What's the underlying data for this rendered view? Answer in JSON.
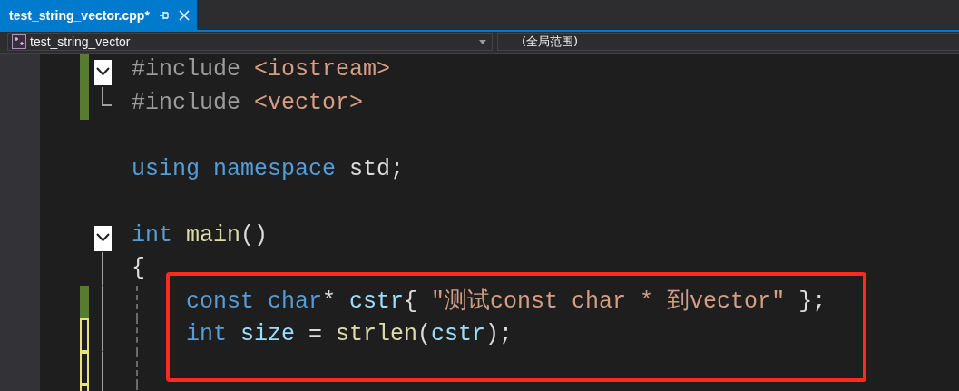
{
  "tabs": [
    {
      "label": "test_string_vector.cpp*",
      "selected": true
    }
  ],
  "nav": {
    "project": "test_string_vector",
    "scope": "(全局范围)"
  },
  "annotation_box": {
    "color": "#ff2a1f"
  },
  "lines": [
    {
      "kind": "fold-start",
      "modified": true,
      "saved": true,
      "guide": false,
      "boxed": false,
      "tokens": [
        {
          "text": "#include ",
          "kind": "preproc"
        },
        {
          "text": "<iostream>",
          "kind": "string"
        }
      ]
    },
    {
      "kind": "fold-end",
      "modified": true,
      "saved": true,
      "guide": false,
      "boxed": false,
      "tokens": [
        {
          "text": "#include ",
          "kind": "preproc"
        },
        {
          "text": "<vector>",
          "kind": "string"
        }
      ]
    },
    {
      "kind": "plain",
      "modified": false,
      "guide": false,
      "boxed": false
    },
    {
      "kind": "plain",
      "modified": false,
      "guide": false,
      "boxed": false,
      "tokens": [
        {
          "text": "using namespace",
          "kind": "keyword"
        },
        {
          "text": " std;",
          "kind": "plain"
        }
      ]
    },
    {
      "kind": "plain",
      "modified": false,
      "guide": false,
      "boxed": false
    },
    {
      "kind": "fold-start",
      "modified": false,
      "guide": false,
      "boxed": false,
      "tokens": [
        {
          "text": "int ",
          "kind": "keyword"
        },
        {
          "text": "main",
          "kind": "function"
        },
        {
          "text": "()",
          "kind": "plain"
        }
      ]
    },
    {
      "kind": "fold-body",
      "modified": false,
      "guide": false,
      "boxed": false,
      "tokens": [
        {
          "text": "{",
          "kind": "plain"
        }
      ]
    },
    {
      "kind": "fold-body",
      "modified": true,
      "saved": true,
      "guide": true,
      "boxed": true,
      "tokens": [
        {
          "text": "const char",
          "kind": "keyword"
        },
        {
          "text": "* ",
          "kind": "plain"
        },
        {
          "text": "cstr",
          "kind": "variable"
        },
        {
          "text": "{ ",
          "kind": "plain"
        },
        {
          "text": "\"测试const char * 到vector\"",
          "kind": "string"
        },
        {
          "text": " };",
          "kind": "plain"
        }
      ]
    },
    {
      "kind": "fold-body",
      "modified": true,
      "saved": false,
      "guide": true,
      "boxed": true,
      "tokens": [
        {
          "text": "int ",
          "kind": "keyword"
        },
        {
          "text": "size",
          "kind": "variable"
        },
        {
          "text": " = ",
          "kind": "plain"
        },
        {
          "text": "strlen",
          "kind": "function"
        },
        {
          "text": "(",
          "kind": "plain"
        },
        {
          "text": "cstr",
          "kind": "variable"
        },
        {
          "text": ");",
          "kind": "plain"
        }
      ]
    },
    {
      "kind": "fold-body",
      "modified": true,
      "saved": false,
      "guide": true,
      "boxed": true
    },
    {
      "kind": "fold-body",
      "modified": true,
      "saved": false,
      "guide": true,
      "boxed": false
    }
  ]
}
